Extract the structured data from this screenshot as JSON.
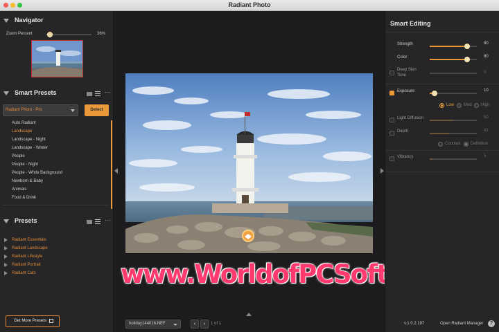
{
  "window": {
    "title": "Radiant Photo"
  },
  "navigator": {
    "title": "Navigator",
    "zoom_label": "Zoom Percent",
    "zoom_value": "36%",
    "zoom_fraction": 0.05
  },
  "smart_presets": {
    "title": "Smart Presets",
    "selected": "Radiant Photo - Pro",
    "detect_label": "Detect",
    "items": [
      "Auto Radiant",
      "Landscape",
      "Landscape - Night",
      "Landscape - Winter",
      "People",
      "People - Night",
      "People - White Background",
      "Newborn & Baby",
      "Animals",
      "Food & Drink"
    ],
    "active_item": "Landscape",
    "more_icon": "ellipsis-icon"
  },
  "presets": {
    "title": "Presets",
    "categories": [
      "Radiant Essentials",
      "Radiant Landscape",
      "Radiant Lifestyle",
      "Radiant Portrait",
      "Radiant Cats"
    ],
    "get_more_label": "Get More Presets"
  },
  "center": {
    "watermark": "www.WorldofPCSoftware.com",
    "file_name": "holiday144016.NEF",
    "page_info": "1 of 1"
  },
  "smart_editing": {
    "title": "Smart Editing",
    "strength": {
      "label": "Strength",
      "value": "80",
      "fraction": 0.8
    },
    "color": {
      "label": "Color",
      "value": "80",
      "fraction": 0.8
    },
    "deep_skin_tone": {
      "label": "Deep Skin Tone",
      "value": "0",
      "fraction": 0.0,
      "checked": false
    },
    "exposure": {
      "label": "Exposure",
      "value": "10",
      "fraction": 0.1,
      "checked": true
    },
    "exposure_levels": [
      "Low",
      "Med",
      "High"
    ],
    "exposure_selected": "Low",
    "light_diffusion": {
      "label": "Light Diffusion",
      "value": "50",
      "fraction": 0.5,
      "checked": false
    },
    "depth": {
      "label": "Depth",
      "value": "41",
      "fraction": 0.41,
      "checked": false
    },
    "depth_modes": [
      "Contrast",
      "Definition"
    ],
    "depth_selected": "Definition",
    "vibrancy": {
      "label": "Vibrancy",
      "value": "5",
      "fraction": 0.05,
      "checked": false
    }
  },
  "footer": {
    "version": "v.1.0.2.197",
    "manager_label": "Open Radiant Manager",
    "help_icon": "?"
  },
  "colors": {
    "accent": "#e9993a",
    "preset_text": "#e28a3a",
    "watermark": "#ff3a6e"
  }
}
